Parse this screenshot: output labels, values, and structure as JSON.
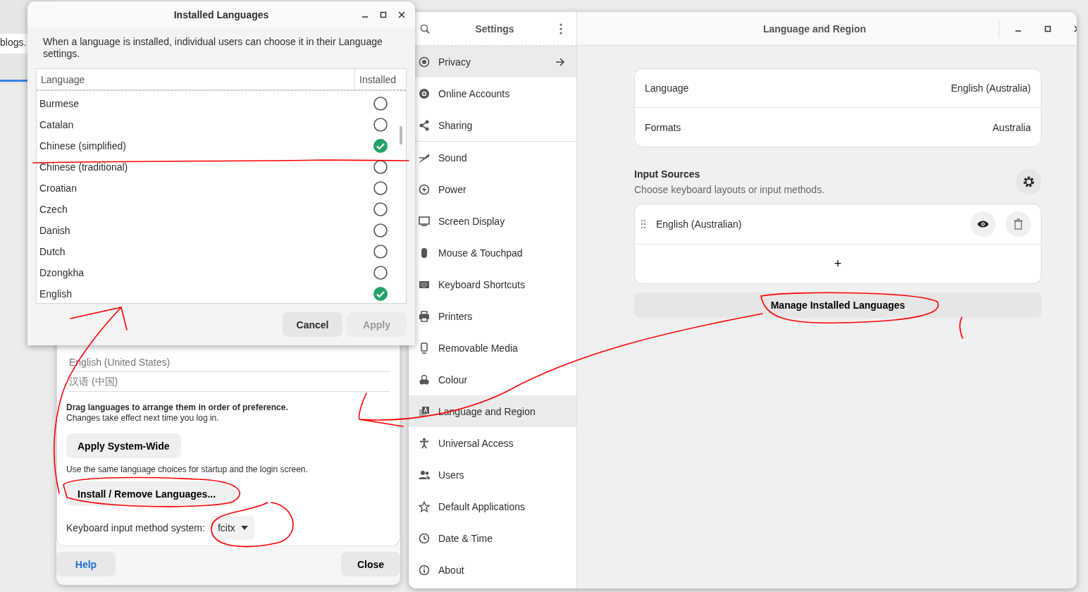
{
  "background_window": {
    "address_text": "blogs."
  },
  "installed_languages_dialog": {
    "title": "Installed Languages",
    "description": "When a language is installed, individual users can choose it in their Language settings.",
    "columns": [
      "Language",
      "Installed"
    ],
    "languages": [
      {
        "name": "Burmese",
        "installed": false
      },
      {
        "name": "Catalan",
        "installed": false
      },
      {
        "name": "Chinese (simplified)",
        "installed": true
      },
      {
        "name": "Chinese (traditional)",
        "installed": false
      },
      {
        "name": "Croatian",
        "installed": false
      },
      {
        "name": "Czech",
        "installed": false
      },
      {
        "name": "Danish",
        "installed": false
      },
      {
        "name": "Dutch",
        "installed": false
      },
      {
        "name": "Dzongkha",
        "installed": false
      },
      {
        "name": "English",
        "installed": true
      }
    ],
    "buttons": [
      {
        "label": "Cancel",
        "disabled": false
      },
      {
        "label": "Apply",
        "disabled": true
      }
    ]
  },
  "language_support_window": {
    "languages": [
      "English (United States)",
      "汉语 (中国)"
    ],
    "drag_hint": "Drag languages to arrange them in order of preference.",
    "drag_note": "Changes take effect next time you log in.",
    "apply_button": "Apply System-Wide",
    "apply_note": "Use the same language choices for startup and the login screen.",
    "install_button": "Install / Remove Languages...",
    "input_method_label": "Keyboard input method system:",
    "input_method_value": "fcitx",
    "help_button": "Help",
    "close_button": "Close"
  },
  "settings": {
    "title": "Settings",
    "sidebar_groups": [
      [
        {
          "label": "Privacy",
          "kind": "privacy",
          "highlighted": true,
          "submenu": true
        },
        {
          "label": "Online Accounts",
          "kind": "accounts",
          "highlighted": false,
          "submenu": false
        },
        {
          "label": "Sharing",
          "kind": "sharing",
          "highlighted": false,
          "submenu": false
        }
      ],
      [
        {
          "label": "Sound",
          "kind": "sound",
          "highlighted": false,
          "submenu": false
        },
        {
          "label": "Power",
          "kind": "power",
          "highlighted": false,
          "submenu": false
        },
        {
          "label": "Screen Display",
          "kind": "display",
          "highlighted": false,
          "submenu": false
        },
        {
          "label": "Mouse & Touchpad",
          "kind": "mouse",
          "highlighted": false,
          "submenu": false
        },
        {
          "label": "Keyboard Shortcuts",
          "kind": "keyboard",
          "highlighted": false,
          "submenu": false
        },
        {
          "label": "Printers",
          "kind": "printer",
          "highlighted": false,
          "submenu": false
        },
        {
          "label": "Removable Media",
          "kind": "media",
          "highlighted": false,
          "submenu": false
        },
        {
          "label": "Colour",
          "kind": "colour",
          "highlighted": false,
          "submenu": false
        },
        {
          "label": "Language and Region",
          "kind": "language",
          "highlighted": true,
          "submenu": false
        },
        {
          "label": "Universal Access",
          "kind": "access",
          "highlighted": false,
          "submenu": false
        },
        {
          "label": "Users",
          "kind": "users",
          "highlighted": false,
          "submenu": false
        },
        {
          "label": "Default Applications",
          "kind": "default",
          "highlighted": false,
          "submenu": false
        },
        {
          "label": "Date & Time",
          "kind": "time",
          "highlighted": false,
          "submenu": false
        },
        {
          "label": "About",
          "kind": "about",
          "highlighted": false,
          "submenu": false
        }
      ]
    ],
    "page": {
      "title": "Language and Region",
      "rows": [
        {
          "label": "Language",
          "value": "English (Australia)"
        },
        {
          "label": "Formats",
          "value": "Australia"
        }
      ],
      "input_sources": {
        "title": "Input Sources",
        "subtitle": "Choose keyboard layouts or input methods.",
        "sources": [
          "English (Australian)"
        ],
        "add_button": "+"
      },
      "manage_button": "Manage Installed Languages"
    }
  }
}
